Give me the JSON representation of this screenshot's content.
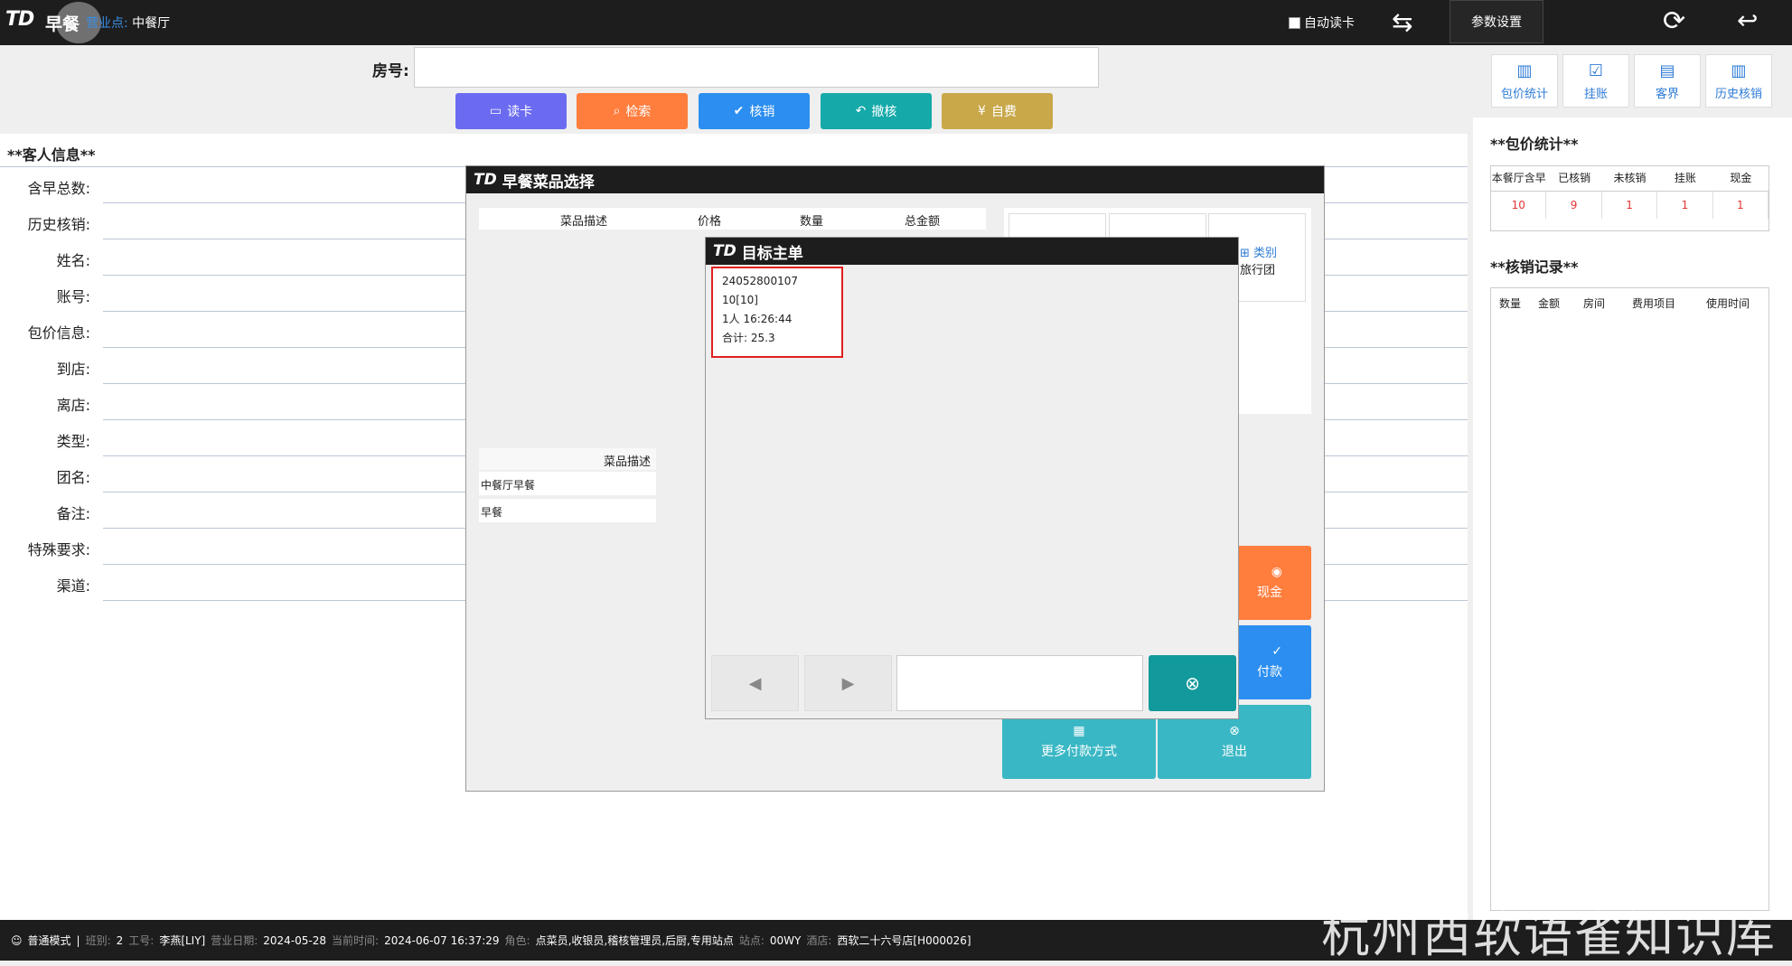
{
  "topbar": {
    "logo": "TD",
    "app_title": "早餐",
    "outlet_label": "营业点:",
    "outlet_value": "中餐厅",
    "auto_read_label": "自动读卡",
    "param_settings_label": "参数设置"
  },
  "room": {
    "label": "房号:",
    "value": ""
  },
  "actions": [
    {
      "label": "读卡",
      "color": "#6b6bf2",
      "icon": "card-icon"
    },
    {
      "label": "检索",
      "color": "#ff7d3d",
      "icon": "search-icon"
    },
    {
      "label": "核销",
      "color": "#2b8ef0",
      "icon": "check-circle-icon"
    },
    {
      "label": "撤核",
      "color": "#15a9a9",
      "icon": "undo-icon"
    },
    {
      "label": "自费",
      "color": "#c9a84a",
      "icon": "yen-icon"
    }
  ],
  "right_tools": [
    {
      "label": "包价统计",
      "icon": "bar-chart-icon"
    },
    {
      "label": "挂账",
      "icon": "monitor-check-icon"
    },
    {
      "label": "客界",
      "icon": "window-icon"
    },
    {
      "label": "历史核销",
      "icon": "bar-chart-icon"
    }
  ],
  "guest_info": {
    "title": "**客人信息**",
    "fields": [
      {
        "label": "含早总数:",
        "value": ""
      },
      {
        "label": "历史核销:",
        "value": ""
      },
      {
        "label": "姓名:",
        "value": ""
      },
      {
        "label": "账号:",
        "value": ""
      },
      {
        "label": "包价信息:",
        "value": ""
      },
      {
        "label": "到店:",
        "value": ""
      },
      {
        "label": "离店:",
        "value": ""
      },
      {
        "label": "类型:",
        "value": ""
      },
      {
        "label": "团名:",
        "value": ""
      },
      {
        "label": "备注:",
        "value": ""
      },
      {
        "label": "特殊要求:",
        "value": ""
      },
      {
        "label": "渠道:",
        "value": ""
      }
    ]
  },
  "package_stats": {
    "title": "**包价统计**",
    "headers": [
      "本餐厅含早",
      "已核销",
      "未核销",
      "挂账",
      "现金"
    ],
    "values": [
      "10",
      "9",
      "1",
      "1",
      "1"
    ]
  },
  "records": {
    "title": "**核销记录**",
    "headers": [
      "数量",
      "金额",
      "房间",
      "费用项目",
      "使用时间"
    ]
  },
  "dialog_breakfast": {
    "title": "早餐菜品选择",
    "headers": [
      "菜品描述",
      "价格",
      "数量",
      "总金额"
    ],
    "item_header": "菜品描述",
    "items": [
      "中餐厅早餐",
      "早餐"
    ],
    "category_label": "类别",
    "category_value": "旅行团",
    "pay_buttons": [
      {
        "label": "现金",
        "color": "#ff7d3d"
      },
      {
        "label": "付款",
        "color": "#2b8ef0"
      },
      {
        "label": "更多付款方式",
        "color": "#3ab7c4"
      },
      {
        "label": "退出",
        "color": "#3ab7c4"
      }
    ]
  },
  "dialog_order": {
    "title": "目标主单",
    "order": {
      "number": "24052800107",
      "table": "10[10]",
      "guests_time": "1人  16:26:44",
      "total": "合计: 25.3"
    }
  },
  "statusbar": {
    "mode": "普通模式",
    "shift_label": "班别:",
    "shift": "2",
    "staff_label": "工号:",
    "staff": "李燕[LIY]",
    "bizdate_label": "营业日期:",
    "bizdate": "2024-05-28",
    "now_label": "当前时间:",
    "now": "2024-06-07 16:37:29",
    "role_label": "角色:",
    "role": "点菜员,收银员,稽核管理员,后厨,专用站点",
    "site_label": "站点:",
    "site": "00WY",
    "hotel_label": "酒店:",
    "hotel": "西软二十六号店[H000026]"
  },
  "watermark": "杭州西软语雀知识库"
}
